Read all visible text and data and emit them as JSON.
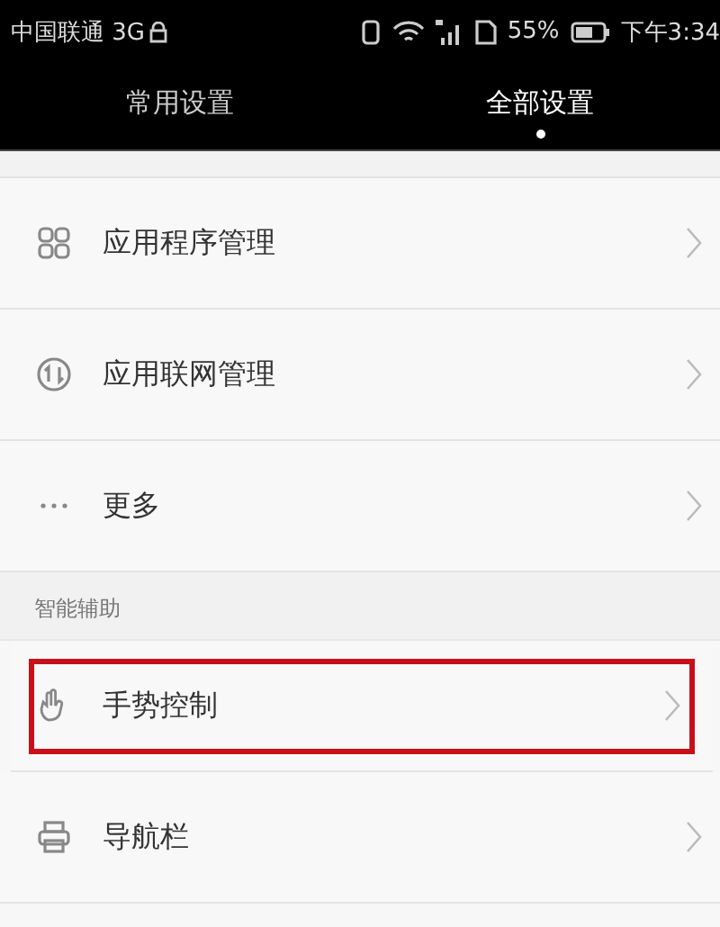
{
  "status_bar": {
    "carrier": "中国联通 3G",
    "battery": "55%",
    "time": "下午3:34"
  },
  "tabs": [
    {
      "label": "常用设置",
      "selected": false
    },
    {
      "label": "全部设置",
      "selected": true
    }
  ],
  "sections": [
    {
      "items": [
        {
          "kind": "apps",
          "label": "应用程序管理",
          "highlighted": false
        },
        {
          "kind": "network",
          "label": "应用联网管理",
          "highlighted": false
        },
        {
          "kind": "more",
          "label": "更多",
          "highlighted": false
        }
      ]
    },
    {
      "header": "智能辅助",
      "items": [
        {
          "kind": "gesture",
          "label": "手势控制",
          "highlighted": true
        },
        {
          "kind": "navbar",
          "label": "导航栏",
          "highlighted": false
        }
      ]
    }
  ]
}
